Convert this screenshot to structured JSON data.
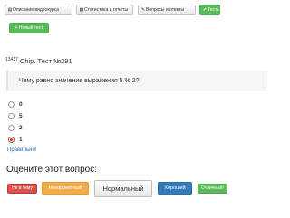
{
  "tabs": [
    {
      "label": "Описание видеокурса",
      "icon": "document-icon",
      "active": false
    },
    {
      "label": "Статистика и отчёты",
      "icon": "chart-icon",
      "active": false
    },
    {
      "label": "Вопросы и ответы",
      "icon": "pencil-icon",
      "active": false
    },
    {
      "label": "Тесты",
      "icon": "check-icon",
      "active": true
    }
  ],
  "new_test_button": "+ Новый тест",
  "test": {
    "id": "13417",
    "title": "Chip. Тест №291",
    "question": "Чему равно значение выражения 5 % 2?",
    "options": [
      {
        "label": "0",
        "selected": false
      },
      {
        "label": "5",
        "selected": false
      },
      {
        "label": "2",
        "selected": false
      },
      {
        "label": "1",
        "selected": true
      }
    ],
    "feedback": "Правильно!"
  },
  "rating": {
    "heading": "Оцените этот вопрос:",
    "buttons": [
      {
        "label": "Не в тему",
        "color": "#d9534f"
      },
      {
        "label": "Некорректный",
        "color": "#f0ad4e"
      },
      {
        "label": "Нормальный",
        "color": "#f0f0f0"
      },
      {
        "label": "Хороший",
        "color": "#337ab7"
      },
      {
        "label": "Отличный!",
        "color": "#5cb85c"
      }
    ]
  },
  "colors": {
    "success": "#5cb85c",
    "link": "#2b64c8",
    "selected_radio": "#c0392b"
  }
}
